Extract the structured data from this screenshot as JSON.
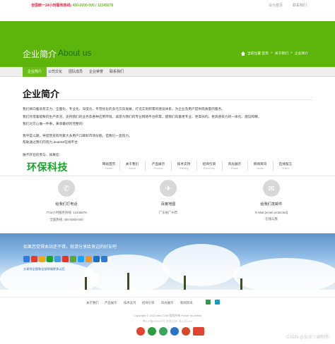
{
  "topbar": {
    "hotline_label": "全国统一24小时服务热线:",
    "hotline_numbers": "400-0000-000 / 12345678",
    "links": [
      "设为首页",
      "联系我们"
    ]
  },
  "banner": {
    "title_cn": "企业简介",
    "title_en": "About us",
    "breadcrumb": [
      "当前位置:首页",
      ">",
      "关于我们",
      ">",
      "企业简介"
    ],
    "color": "#5db40b"
  },
  "subnav": {
    "items": [
      "企业简介",
      "公司文化",
      "团队成员",
      "企业荣誉",
      "联系我们"
    ],
    "active": "企业简介",
    "accent": "#6cbd1a"
  },
  "main": {
    "heading": "企业简介",
    "paragraphs": [
      "我们将向着具有实力、全面化、专业化、深度化、专营优化的多元方向发展，打造实则积累的建设体系，为企业及用户提供高质量的服务。",
      "我们凭借着极致的生产状况，支持我们的业务及各种应用环境，诚恳为我们的专业网络平台积累，使我们向着更专业、更高效的、更具感染力的一体化、建议和精，",
      "我们对方心做一件事，秉承最好的完整的!",
      "我平是以期，导提营技有利聚大多用户口碑和市场份额，但我们一直努力。",
      "帮助通过我们的努力,dede58在线平台",
      "展不开狂的参与、如果您:"
    ]
  },
  "brand": {
    "logo_text": "环保科技",
    "logo_color": "#1aa32b"
  },
  "mainnav": [
    {
      "cn": "网站首页",
      "en": "Home"
    },
    {
      "cn": "关于我们",
      "en": "About"
    },
    {
      "cn": "产品展示",
      "en": "Product"
    },
    {
      "cn": "技术支持",
      "en": "Training"
    },
    {
      "cn": "招商引资",
      "en": "Discovery"
    },
    {
      "cn": "风光展示",
      "en": "Photo"
    },
    {
      "cn": "新闻资讯",
      "en": "News"
    },
    {
      "cn": "在线留言",
      "en": "Online"
    }
  ],
  "contact": [
    {
      "icon": "phone-icon",
      "glyph": "✆",
      "title": "给我们打电话",
      "line1": "7*24小时服务热线: 12345678",
      "line2": "全国热线: 400-0000-000"
    },
    {
      "icon": "plane-icon",
      "glyph": "✈",
      "title": "百度地图",
      "line1": "广东省广州市",
      "line2": ""
    },
    {
      "icon": "mail-icon",
      "glyph": "✉",
      "title": "给我们发邮件",
      "line1": "E-Mail:[email protected]",
      "line2": "在线与我"
    }
  ],
  "share": {
    "prompt": "如果您觉得本站还不错，就请分享给身边的好友吧",
    "icon_colors": [
      "#2a7be4",
      "#e53b2c",
      "#f2a900",
      "#1aa32b",
      "#3a9ee0",
      "#e2362a",
      "#59a92f",
      "#1da1f2",
      "#f7941d",
      "#1b6fc8",
      "#2c7ad6"
    ],
    "follow_text": "分享到全国和全部领域更多以后"
  },
  "footer": {
    "links": [
      "关于我们",
      "产品展示",
      "技术支持",
      "招商引资",
      "风光展示",
      "新闻资讯"
    ],
    "copyright": "Copyright © 2024 abc.COM 版权所有 Power by adfink",
    "icp": "粤ICP备000000号 技术支持: 本公司-xxx"
  },
  "watermark": "CSDN @仙女☆颖制作"
}
